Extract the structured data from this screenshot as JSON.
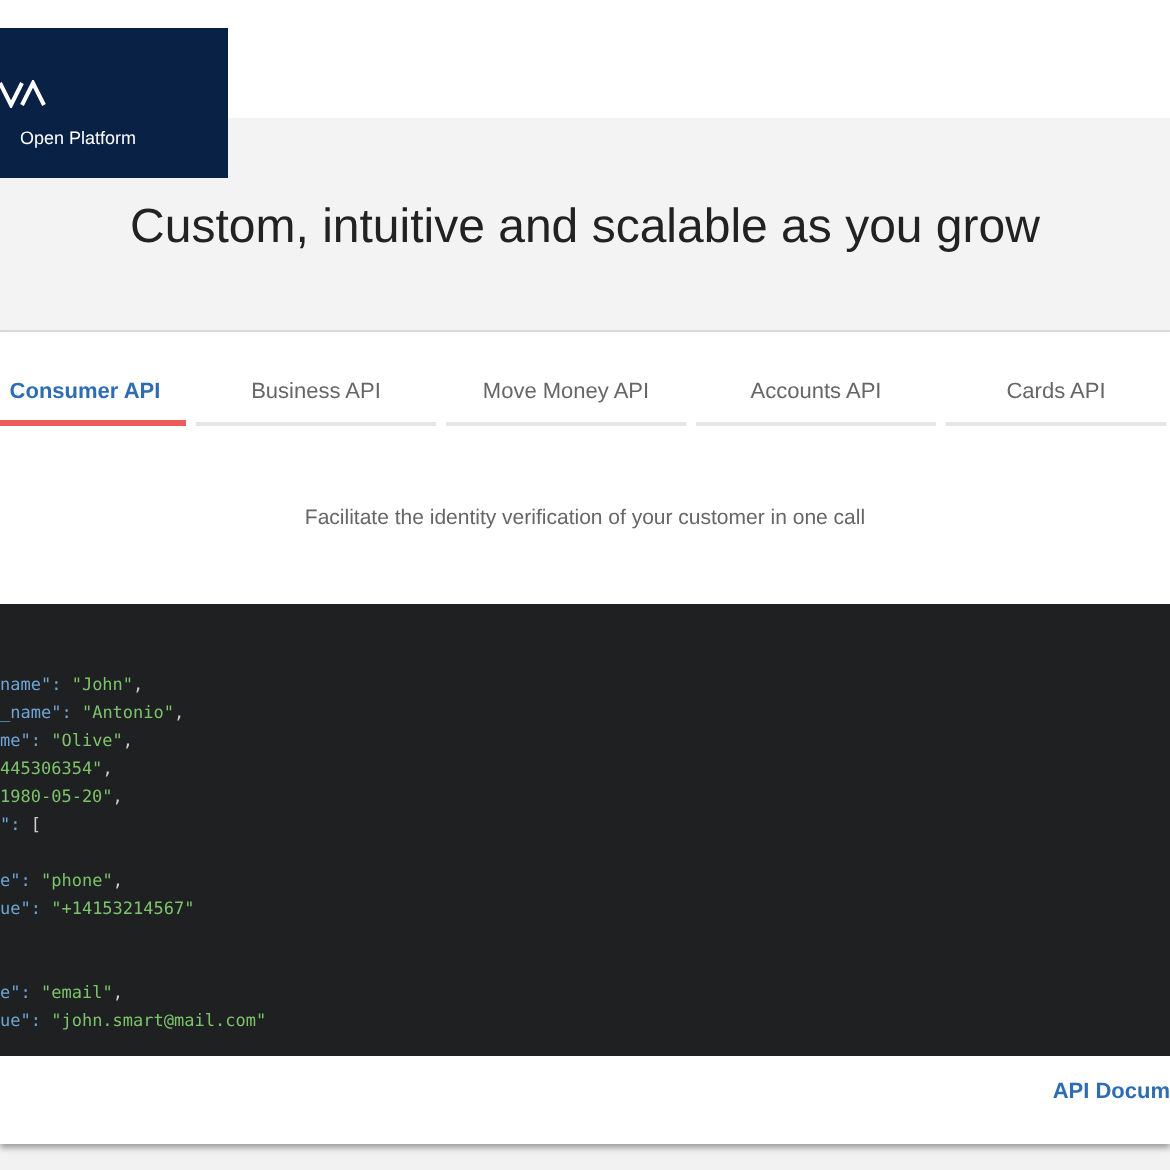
{
  "logo": {
    "caption": "Open Platform"
  },
  "hero": {
    "title": "Custom, intuitive and scalable as you grow"
  },
  "tabs": [
    {
      "label": "Consumer API",
      "selected": true
    },
    {
      "label": "Business API",
      "selected": false
    },
    {
      "label": "Move Money API",
      "selected": false
    },
    {
      "label": "Accounts API",
      "selected": false
    },
    {
      "label": "Cards API",
      "selected": false
    }
  ],
  "description": "Facilitate the identity verification of your customer in one call",
  "code_blocks": [
    [
      [
        {
          "kind": "key",
          "text": "name\": "
        },
        {
          "kind": "string",
          "text": "\"John\""
        },
        {
          "kind": "punct",
          "text": ","
        }
      ],
      [
        {
          "kind": "key",
          "text": "_name\": "
        },
        {
          "kind": "string",
          "text": "\"Antonio\""
        },
        {
          "kind": "punct",
          "text": ","
        }
      ],
      [
        {
          "kind": "key",
          "text": "me\": "
        },
        {
          "kind": "string",
          "text": "\"Olive\""
        },
        {
          "kind": "punct",
          "text": ","
        }
      ],
      [
        {
          "kind": "string",
          "text": "445306354\""
        },
        {
          "kind": "punct",
          "text": ","
        }
      ],
      [
        {
          "kind": "string",
          "text": "1980-05-20\""
        },
        {
          "kind": "punct",
          "text": ","
        }
      ],
      [
        {
          "kind": "key",
          "text": "\": "
        },
        {
          "kind": "punct",
          "text": "["
        }
      ]
    ],
    [
      [
        {
          "kind": "key",
          "text": "e\": "
        },
        {
          "kind": "string",
          "text": "\"phone\""
        },
        {
          "kind": "punct",
          "text": ","
        }
      ],
      [
        {
          "kind": "key",
          "text": "ue\": "
        },
        {
          "kind": "string",
          "text": "\"+14153214567\""
        }
      ]
    ],
    [
      [
        {
          "kind": "key",
          "text": "e\": "
        },
        {
          "kind": "string",
          "text": "\"email\""
        },
        {
          "kind": "punct",
          "text": ","
        }
      ],
      [
        {
          "kind": "key",
          "text": "ue\": "
        },
        {
          "kind": "string",
          "text": "\"john.smart@mail.com\""
        }
      ]
    ]
  ],
  "docs_link": "API Docum"
}
